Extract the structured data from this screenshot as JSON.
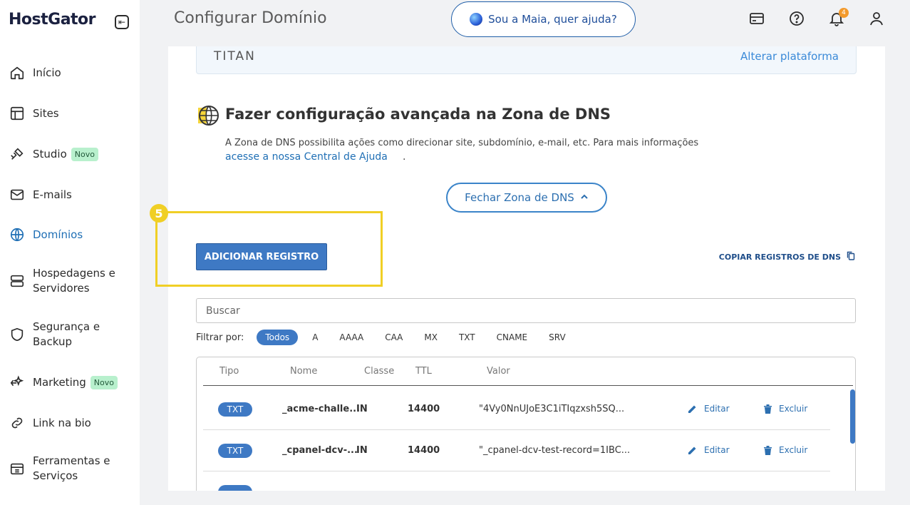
{
  "app": {
    "logo": "HostGator"
  },
  "sidebar": {
    "items": [
      {
        "label": "Início",
        "icon": "home-icon",
        "active": false
      },
      {
        "label": "Sites",
        "icon": "layout-icon",
        "active": false
      },
      {
        "label": "Studio",
        "icon": "studio-icon",
        "badge": "Novo",
        "active": false
      },
      {
        "label": "E-mails",
        "icon": "mail-icon",
        "active": false
      },
      {
        "label": "Domínios",
        "icon": "globe-icon",
        "active": true
      },
      {
        "label": "Hospedagens e Servidores",
        "icon": "server-icon",
        "active": false
      },
      {
        "label": "Segurança e Backup",
        "icon": "shield-icon",
        "active": false
      },
      {
        "label": "Marketing",
        "icon": "marketing-icon",
        "badge": "Novo",
        "active": false
      },
      {
        "label": "Link na bio",
        "icon": "link-icon",
        "active": false
      },
      {
        "label": "Ferramentas e Serviços",
        "icon": "tools-icon",
        "active": false
      }
    ]
  },
  "header": {
    "title": "Configurar Domínio",
    "assistant_label": "Sou a Maia, quer ajuda?",
    "notification_count": "4"
  },
  "titan": {
    "logo": "TITAN",
    "change_platform": "Alterar plataforma"
  },
  "dns": {
    "title": "Fazer configuração avançada na Zona de DNS",
    "description": "A Zona de DNS possibilita ações como direcionar site, subdomínio, e-mail, etc. Para mais informações",
    "help_link": "acesse a nossa Central de Ajuda",
    "help_suffix": ".",
    "close_button": "Fechar Zona de DNS",
    "add_button": "ADICIONAR REGISTRO",
    "copy_button": "COPIAR REGISTROS DE DNS",
    "search_placeholder": "Buscar",
    "filter_label": "Filtrar por:",
    "filters": [
      "Todos",
      "A",
      "AAAA",
      "CAA",
      "MX",
      "TXT",
      "CNAME",
      "SRV"
    ],
    "active_filter": "Todos",
    "columns": [
      "Tipo",
      "Nome",
      "Classe",
      "TTL",
      "Valor"
    ],
    "rows": [
      {
        "type": "TXT",
        "name": "_acme-challe...",
        "class": "IN",
        "ttl": "14400",
        "value": "\"4Vy0NnUJoE3C1iTIqzxsh5SQ...",
        "edit": "Editar",
        "delete": "Excluir"
      },
      {
        "type": "TXT",
        "name": "_cpanel-dcv-...",
        "class": "IN",
        "ttl": "14400",
        "value": "\"_cpanel-dcv-test-record=1IBC...",
        "edit": "Editar",
        "delete": "Excluir"
      }
    ]
  },
  "annotation": {
    "step": "5",
    "color": "#f0cf25"
  }
}
